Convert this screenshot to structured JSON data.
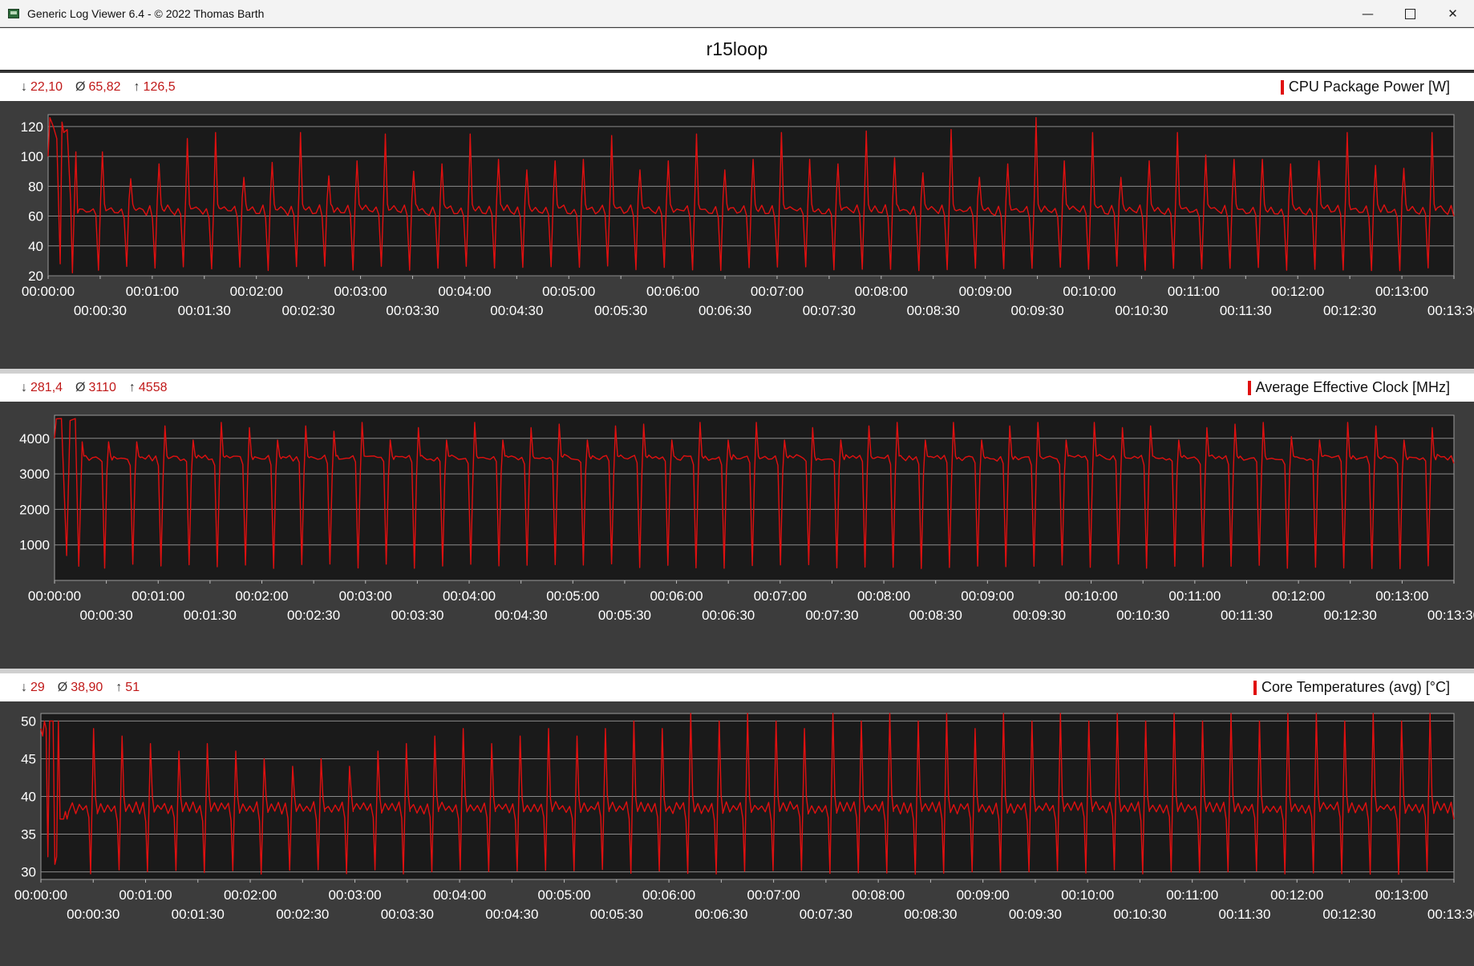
{
  "window": {
    "title": "Generic Log Viewer 6.4 - © 2022 Thomas Barth",
    "minimize_icon": "minimize-icon",
    "maximize_icon": "maximize-icon",
    "close_icon": "close-icon"
  },
  "document_title": "r15loop",
  "colors": {
    "series": "#e01010",
    "plot_bg": "#1a1a1a",
    "panel_bg": "#3c3c3c",
    "grid": "#8a8a8a",
    "stats_text": "#c01818"
  },
  "panels": [
    {
      "sensor": "CPU Package Power [W]",
      "stats": {
        "min_symbol": "↓",
        "min": "22,10",
        "avg_symbol": "Ø",
        "avg": "65,82",
        "max_symbol": "↑",
        "max": "126,5"
      }
    },
    {
      "sensor": "Average Effective Clock [MHz]",
      "stats": {
        "min_symbol": "↓",
        "min": "281,4",
        "avg_symbol": "Ø",
        "avg": "3110",
        "max_symbol": "↑",
        "max": "4558"
      }
    },
    {
      "sensor": "Core Temperatures (avg) [°C]",
      "stats": {
        "min_symbol": "↓",
        "min": "29",
        "avg_symbol": "Ø",
        "avg": "38,90",
        "max_symbol": "↑",
        "max": "51"
      }
    }
  ],
  "chart_data": [
    {
      "type": "line",
      "title": "CPU Package Power [W]",
      "xlabel": "",
      "ylabel": "",
      "x_range_seconds": [
        0,
        810
      ],
      "ylim": [
        20,
        128
      ],
      "yticks": [
        20,
        40,
        60,
        80,
        100,
        120
      ],
      "xticks_top": [
        "00:00:00",
        "00:01:00",
        "00:02:00",
        "00:03:00",
        "00:04:00",
        "00:05:00",
        "00:06:00",
        "00:07:00",
        "00:08:00",
        "00:09:00",
        "00:10:00",
        "00:11:00",
        "00:12:00",
        "00:13:00"
      ],
      "xticks_bottom": [
        "00:00:30",
        "00:01:30",
        "00:02:30",
        "00:03:30",
        "00:04:30",
        "00:05:30",
        "00:06:30",
        "00:07:30",
        "00:08:30",
        "00:09:30",
        "00:10:30",
        "00:11:30",
        "00:12:30",
        "00:13:30"
      ],
      "grid": true,
      "legend": "top-right",
      "cycle_period_s": 16.3,
      "cycle_profile": [
        [
          0,
          65
        ],
        [
          1,
          64
        ],
        [
          3,
          66
        ],
        [
          5,
          63
        ],
        [
          7,
          62
        ],
        [
          9,
          66
        ],
        [
          10.5,
          60
        ],
        [
          12,
          25
        ],
        [
          13.3,
          72
        ],
        [
          14.3,
          110
        ],
        [
          15.5,
          68
        ]
      ],
      "start_segment": [
        [
          0,
          100
        ],
        [
          1,
          126
        ],
        [
          3,
          120
        ],
        [
          5,
          112
        ],
        [
          7,
          28
        ],
        [
          8,
          123
        ],
        [
          9,
          116
        ],
        [
          11,
          118
        ],
        [
          13,
          70
        ],
        [
          14,
          22
        ],
        [
          16,
          103
        ],
        [
          17,
          62
        ]
      ],
      "series": [
        {
          "name": "CPU Package Power [W]",
          "peaks": [
            103,
            85,
            95,
            112,
            116,
            86,
            96,
            116,
            87,
            97,
            115,
            90,
            95,
            115,
            98,
            91,
            97,
            98,
            114,
            91,
            97,
            115,
            91,
            98,
            116,
            98,
            95,
            117,
            99,
            89,
            118,
            86,
            95,
            126,
            97,
            116,
            86,
            97,
            116,
            101,
            98,
            98,
            95,
            97,
            116,
            94,
            92,
            116,
            86,
            96,
            116,
            94,
            85,
            115,
            90,
            84,
            115
          ]
        }
      ]
    },
    {
      "type": "line",
      "title": "Average Effective Clock [MHz]",
      "xlabel": "",
      "ylabel": "",
      "x_range_seconds": [
        0,
        810
      ],
      "ylim": [
        0,
        4650
      ],
      "yticks": [
        1000,
        2000,
        3000,
        4000
      ],
      "xticks_top": [
        "00:00:00",
        "00:01:00",
        "00:02:00",
        "00:03:00",
        "00:04:00",
        "00:05:00",
        "00:06:00",
        "00:07:00",
        "00:08:00",
        "00:09:00",
        "00:10:00",
        "00:11:00",
        "00:12:00",
        "00:13:00"
      ],
      "xticks_bottom": [
        "00:00:30",
        "00:01:30",
        "00:02:30",
        "00:03:30",
        "00:04:30",
        "00:05:30",
        "00:06:30",
        "00:07:30",
        "00:08:30",
        "00:09:30",
        "00:10:30",
        "00:11:30",
        "00:12:30",
        "00:13:30"
      ],
      "grid": true,
      "legend": "top-right",
      "cycle_period_s": 16.3,
      "cycle_profile": [
        [
          0,
          3450
        ],
        [
          1,
          3480
        ],
        [
          3,
          3440
        ],
        [
          5,
          3470
        ],
        [
          7,
          3430
        ],
        [
          9,
          3460
        ],
        [
          10.5,
          3300
        ],
        [
          12,
          400
        ],
        [
          13.3,
          3000
        ],
        [
          14.3,
          4000
        ],
        [
          15.5,
          3500
        ]
      ],
      "start_segment": [
        [
          0,
          4000
        ],
        [
          1,
          4550
        ],
        [
          4,
          4558
        ],
        [
          7,
          700
        ],
        [
          9,
          4500
        ],
        [
          12,
          4558
        ],
        [
          14,
          400
        ],
        [
          16,
          3900
        ],
        [
          17,
          3500
        ]
      ],
      "series": [
        {
          "name": "Average Effective Clock [MHz]",
          "peaks": [
            3900,
            3900,
            4350,
            3950,
            4450,
            4300,
            3950,
            4350,
            4200,
            4450,
            3950,
            4300,
            3950,
            4450,
            3950,
            4300,
            4400,
            3950,
            4350,
            4400,
            3950,
            4450,
            3950,
            4450,
            3950,
            4300,
            3950,
            4350,
            4450,
            3950,
            4450,
            3950,
            4350,
            4450,
            3950,
            4450,
            4300,
            4350,
            3950,
            4300,
            4400,
            4450,
            4050,
            3950,
            4450,
            4350,
            3950,
            4300,
            4350,
            3950,
            4300,
            4350,
            3950,
            4300,
            3950,
            4300,
            4250
          ]
        }
      ]
    },
    {
      "type": "line",
      "title": "Core Temperatures (avg) [°C]",
      "xlabel": "",
      "ylabel": "",
      "x_range_seconds": [
        0,
        810
      ],
      "ylim": [
        29,
        51
      ],
      "yticks": [
        30,
        35,
        40,
        45,
        50
      ],
      "xticks_top": [
        "00:00:00",
        "00:01:00",
        "00:02:00",
        "00:03:00",
        "00:04:00",
        "00:05:00",
        "00:06:00",
        "00:07:00",
        "00:08:00",
        "00:09:00",
        "00:10:00",
        "00:11:00",
        "00:12:00",
        "00:13:00"
      ],
      "xticks_bottom": [
        "00:00:30",
        "00:01:30",
        "00:02:30",
        "00:03:30",
        "00:04:30",
        "00:05:30",
        "00:06:30",
        "00:07:30",
        "00:08:30",
        "00:09:30",
        "00:10:30",
        "00:11:30",
        "00:12:30",
        "00:13:30"
      ],
      "grid": true,
      "legend": "top-right",
      "cycle_period_s": 16.3,
      "cycle_profile": [
        [
          0,
          38
        ],
        [
          2,
          39
        ],
        [
          4,
          38
        ],
        [
          6,
          39
        ],
        [
          8,
          38
        ],
        [
          10,
          39
        ],
        [
          11.5,
          37
        ],
        [
          12.5,
          30
        ],
        [
          14.2,
          51
        ],
        [
          15.3,
          40
        ],
        [
          16.3,
          38
        ]
      ],
      "start_segment": [
        [
          0,
          49
        ],
        [
          1,
          48
        ],
        [
          2,
          50
        ],
        [
          3,
          49
        ],
        [
          4,
          32
        ],
        [
          5,
          50
        ],
        [
          7,
          50
        ],
        [
          8,
          31
        ],
        [
          9,
          32
        ],
        [
          10,
          50
        ],
        [
          11,
          37
        ],
        [
          13,
          37
        ],
        [
          14,
          38
        ],
        [
          15,
          37
        ],
        [
          16,
          38
        ]
      ],
      "series": [
        {
          "name": "Core Temperatures (avg) [°C]",
          "peaks": [
            49,
            48,
            47,
            46,
            47,
            46,
            45,
            44,
            45,
            44,
            46,
            47,
            48,
            49,
            47,
            48,
            49,
            48,
            49,
            50,
            49,
            51,
            50,
            51,
            50,
            49,
            51,
            50,
            51,
            50,
            51,
            49,
            51,
            50,
            51,
            50,
            51,
            50,
            51,
            50,
            51,
            50,
            51,
            51,
            50,
            51,
            50,
            51,
            50,
            51,
            50,
            51,
            50,
            51,
            50,
            48,
            45
          ]
        }
      ]
    }
  ]
}
